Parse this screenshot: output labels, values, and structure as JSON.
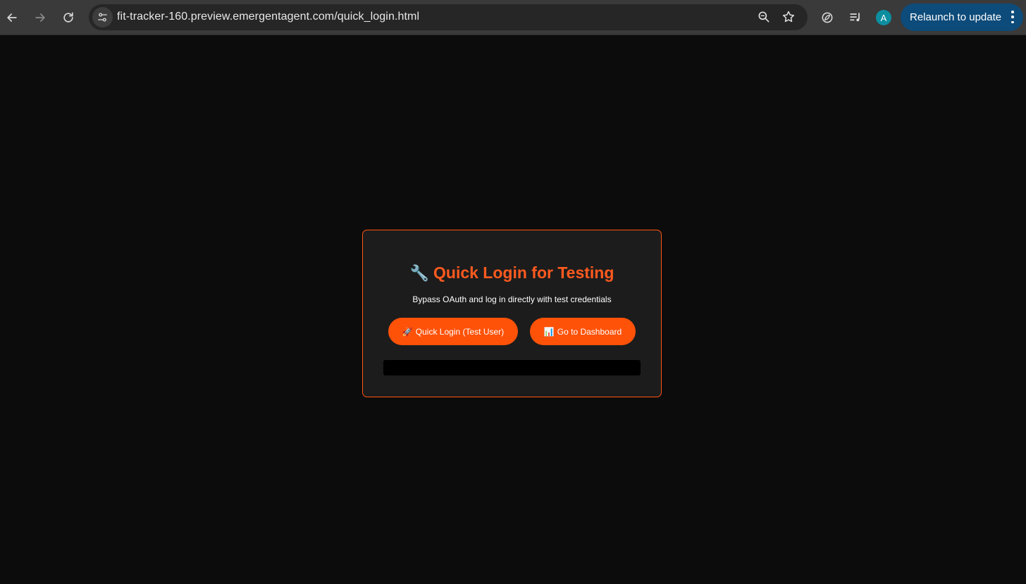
{
  "browser": {
    "url": "fit-tracker-160.preview.emergentagent.com/quick_login.html",
    "back_icon": "arrow-left-icon",
    "forward_icon": "arrow-right-icon",
    "reload_icon": "reload-icon",
    "site_info_icon": "tune-icon",
    "zoom_icon": "magnifier-icon",
    "bookmark_icon": "star-icon",
    "extension_icon": "leaf-icon",
    "media_icon": "media-queue-icon",
    "profile_initial": "A",
    "relaunch_label": "Relaunch to update",
    "accent": "#0d4b7a"
  },
  "card": {
    "title_icon": "🔧",
    "title": "Quick Login for Testing",
    "subtitle": "Bypass OAuth and log in directly with test credentials",
    "buttons": [
      {
        "emoji": "🚀",
        "label": "Quick Login (Test User)"
      },
      {
        "emoji": "📊",
        "label": "Go to Dashboard"
      }
    ],
    "status_text": "",
    "accent": "#ff5209"
  }
}
